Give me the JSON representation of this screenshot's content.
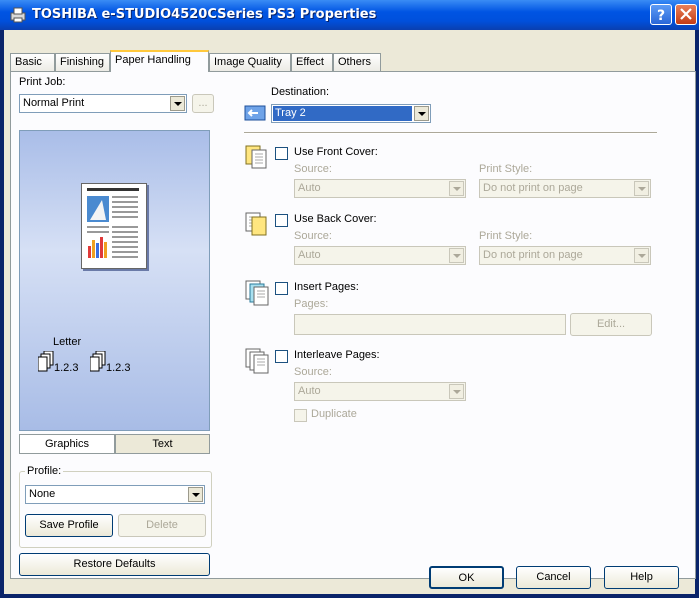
{
  "title": "TOSHIBA e-STUDIO4520CSeries PS3 Properties",
  "tabs": [
    "Basic",
    "Finishing",
    "Paper Handling",
    "Image Quality",
    "Effect",
    "Others"
  ],
  "active_tab": "Paper Handling",
  "print_job": {
    "label": "Print Job:",
    "value": "Normal Print",
    "more_button": "..."
  },
  "preview": {
    "paper_size": "Letter",
    "order_a": "1.2.3",
    "order_b": "1.2.3"
  },
  "view_toggle": {
    "graphics": "Graphics",
    "text": "Text"
  },
  "profile": {
    "label": "Profile:",
    "value": "None",
    "save_button": "Save Profile",
    "delete_button": "Delete"
  },
  "restore_button": "Restore Defaults",
  "destination": {
    "label": "Destination:",
    "value": "Tray 2"
  },
  "front_cover": {
    "label": "Use Front Cover:",
    "source_label": "Source:",
    "source_value": "Auto",
    "style_label": "Print Style:",
    "style_value": "Do not print on page"
  },
  "back_cover": {
    "label": "Use Back Cover:",
    "source_label": "Source:",
    "source_value": "Auto",
    "style_label": "Print Style:",
    "style_value": "Do not print on page"
  },
  "insert_pages": {
    "label": "Insert Pages:",
    "pages_label": "Pages:",
    "pages_value": "",
    "edit_button": "Edit..."
  },
  "interleave": {
    "label": "Interleave Pages:",
    "source_label": "Source:",
    "source_value": "Auto",
    "duplicate_label": "Duplicate"
  },
  "footer": {
    "ok": "OK",
    "cancel": "Cancel",
    "help": "Help"
  }
}
